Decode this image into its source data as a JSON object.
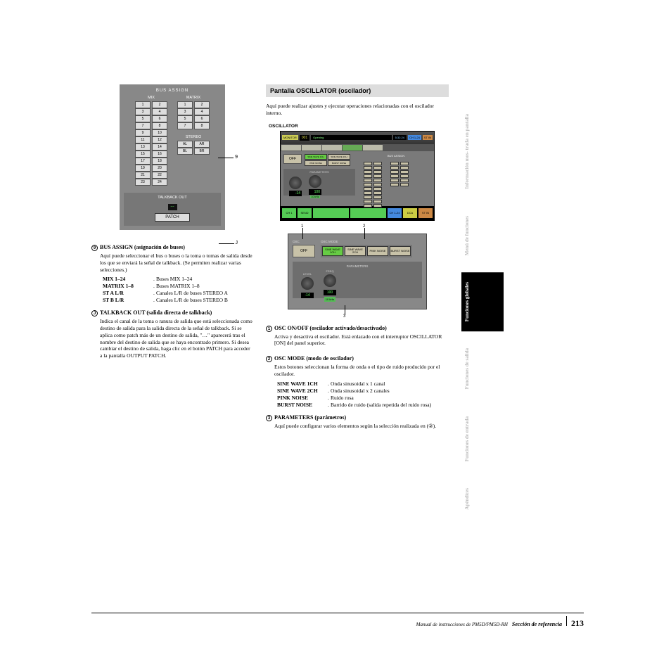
{
  "left": {
    "bus_panel": {
      "title": "BUS ASSIGN",
      "col1_title": "MIX",
      "col2_title": "MATRIX",
      "mix_buttons": [
        [
          "1",
          "2"
        ],
        [
          "3",
          "4"
        ],
        [
          "5",
          "6"
        ],
        [
          "7",
          "8"
        ],
        [
          "9",
          "10"
        ],
        [
          "11",
          "12"
        ],
        [
          "13",
          "14"
        ],
        [
          "15",
          "16"
        ],
        [
          "17",
          "18"
        ],
        [
          "19",
          "20"
        ],
        [
          "21",
          "22"
        ],
        [
          "23",
          "24"
        ]
      ],
      "matrix_buttons": [
        [
          "1",
          "2"
        ],
        [
          "3",
          "4"
        ],
        [
          "5",
          "6"
        ],
        [
          "7",
          "8"
        ]
      ],
      "stereo_title": "STEREO",
      "stereo_buttons": [
        [
          "AL",
          "AR"
        ],
        [
          "BL",
          "BR"
        ]
      ],
      "talkback_title": "TALKBACK OUT",
      "talkback_value": "---",
      "patch_btn": "PATCH"
    },
    "callout_9": "9",
    "callout_10": "J",
    "sec9_title": "BUS ASSIGN (asignación de buses)",
    "sec9_body": "Aquí puede seleccionar el bus o buses o la toma o tomas de salida desde los que se enviará la señal de talkback. (Se permiten realizar varias selecciones.)",
    "sec9_rows": [
      {
        "term": "MIX 1–24",
        "def": "Buses MIX 1–24"
      },
      {
        "term": "MATRIX 1–8",
        "def": "Buses MATRIX 1–8"
      },
      {
        "term": "ST A L/R",
        "def": "Canales L/R de buses STEREO A"
      },
      {
        "term": "ST B L/R",
        "def": "Canales L/R de buses STEREO B"
      }
    ],
    "sec10_title": "TALKBACK OUT (salida directa de talkback)",
    "sec10_body": "Indica el canal de la toma o ranura de salida que está seleccionada como destino de salida para la salida directa de la señal de talkback. Si se aplica como patch más de un destino de salida, \"…\" aparecerá tras el nombre del destino de salida que se haya encontrado primero. Si desea cambiar el destino de salida, haga clic en el botón PATCH para acceder a la pantalla OUTPUT PATCH."
  },
  "right": {
    "header": "Pantalla OSCILLATOR (oscilador)",
    "intro": "Aquí puede realizar ajustes y ejecutar operaciones relacionadas con el oscilador interno.",
    "osc_label": "OSCILLATOR",
    "screen": {
      "scene_num": "001",
      "scene_name": "Opening",
      "time": "5:32:24",
      "tabs_top_right": [
        "CH 1-24",
        "ST IN"
      ],
      "osc_off": "OFF",
      "modes": [
        "SINE WAVE 1CH",
        "SINE WAVE 2CH",
        "PINK NOISE",
        "BURST NOISE"
      ],
      "level_val": "-14",
      "freq_val": "100",
      "hz_btn": "10 kHz",
      "bus_title": "BUS ASSIGN",
      "bottom_tabs": [
        {
          "label": "CH 1",
          "cls": "tab-g"
        },
        {
          "label": "SEND",
          "cls": "tab-g"
        },
        {
          "label": "",
          "cls": "tab-g"
        },
        {
          "label": "",
          "cls": "tab-g"
        },
        {
          "label": "CH 1-24",
          "cls": "tab-b"
        },
        {
          "label": "DCA",
          "cls": "tab-y"
        },
        {
          "label": "ST IN",
          "cls": "tab-o"
        }
      ]
    },
    "detail": {
      "osc_off": "OFF",
      "mode_title": "OSC MODE",
      "modes": [
        {
          "label": "SINE WAVE 1CH",
          "on": true
        },
        {
          "label": "SINE WAVE 2CH",
          "on": false
        },
        {
          "label": "PINK NOISE",
          "on": false
        },
        {
          "label": "BURST NOISE",
          "on": false
        }
      ],
      "param_title": "PARAMETERS",
      "level_label": "LEVEL",
      "freq_label": "FREQ",
      "level_val": "-14",
      "freq_val": "100",
      "hz_btn": "10 kHz",
      "c1": "1",
      "c2": "2",
      "c3": "3"
    },
    "sec1_title": "OSC ON/OFF (oscilador activado/desactivado)",
    "sec1_body": "Activa y desactiva el oscilador. Está enlazado con el interruptor OSCILLATOR [ON] del panel superior.",
    "sec2_title": "OSC MODE (modo de oscilador)",
    "sec2_body": "Estos botones seleccionan la forma de onda o el tipo de ruido producido por el oscilador.",
    "sec2_rows": [
      {
        "term": "SINE WAVE 1CH",
        "def": "Onda sinusoidal x 1 canal"
      },
      {
        "term": "SINE WAVE 2CH",
        "def": "Onda sinusoidal x 2 canales"
      },
      {
        "term": "PINK NOISE",
        "def": "Ruido rosa"
      },
      {
        "term": "BURST NOISE",
        "def": "Barrido de ruido (salida repetida del ruido rosa)"
      }
    ],
    "sec3_title": "PARAMETERS (parámetros)",
    "sec3_body": "Aquí puede configurar varios elementos según la selección realizada en (②)."
  },
  "sidebar": [
    {
      "label": "Información mos-\ntrada en pantalla",
      "active": false
    },
    {
      "label": "Menú de\nfunciones",
      "active": false
    },
    {
      "label": "Funciones\nglobales",
      "active": true
    },
    {
      "label": "Funciones\nde salida",
      "active": false
    },
    {
      "label": "Funciones\nde entrada",
      "active": false
    },
    {
      "label": "Apéndices",
      "active": false
    }
  ],
  "footer": {
    "manual": "Manual de instrucciones de PM5D/PM5D-RH",
    "section": "Sección de referencia",
    "page": "213"
  }
}
